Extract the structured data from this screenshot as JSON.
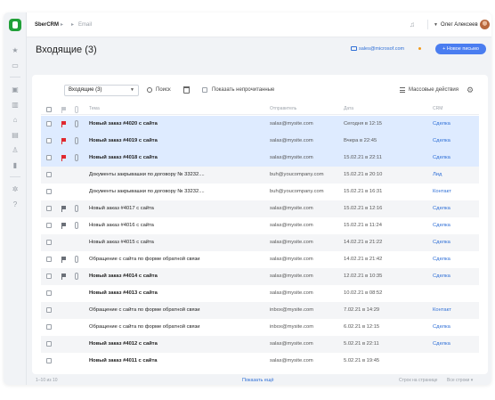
{
  "breadcrumb": {
    "app": "SberCRM",
    "sep": "▸",
    "section": "Email"
  },
  "user": {
    "name": "Олег Алексеев"
  },
  "page": {
    "title": "Входящие (3)",
    "mail_account": "sales@microsof.com",
    "new_email_label": "Новое письмо"
  },
  "toolbar": {
    "folder": "Входящие (3)",
    "search_label": "Поиск",
    "show_unread_label": "Показать непрочитанные",
    "mass_actions_label": "Массовые действия"
  },
  "table": {
    "headers": {
      "subject": "Тема",
      "from": "Отправитель",
      "date": "Дата",
      "crm": "CRM"
    },
    "rows": [
      {
        "selected": true,
        "unread": true,
        "flag": "red",
        "attachment": true,
        "subject": "Новый заказ #4020 с сайта",
        "from": "salas@mysite.com",
        "date": "Сегодня в 12:15",
        "crm": "Сделка"
      },
      {
        "selected": true,
        "unread": true,
        "flag": "red",
        "attachment": true,
        "subject": "Новый заказ #4019 с сайта",
        "from": "salas@mysite.com",
        "date": "Вчера в 22:45",
        "crm": "Сделка"
      },
      {
        "selected": true,
        "unread": true,
        "flag": "red",
        "attachment": true,
        "subject": "Новый заказ #4018 с сайта",
        "from": "salas@mysite.com",
        "date": "15.02.21 в 22:11",
        "crm": "Сделка"
      },
      {
        "selected": false,
        "unread": false,
        "flag": "",
        "attachment": false,
        "subject": "Документы закрывашки по договору № 33232....",
        "from": "buh@youcompany.com",
        "date": "15.02.21 в 20:10",
        "crm": "Лид"
      },
      {
        "selected": false,
        "unread": false,
        "flag": "",
        "attachment": false,
        "subject": "Документы закрывашки по договору № 33232....",
        "from": "buh@youcompany.com",
        "date": "15.02.21 в 16:31",
        "crm": "Контакт"
      },
      {
        "selected": false,
        "unread": false,
        "flag": "gray",
        "attachment": true,
        "subject": "Новый заказ #4017 с сайта",
        "from": "salas@mysite.com",
        "date": "15.02.21 в 12:16",
        "crm": "Сделка"
      },
      {
        "selected": false,
        "unread": false,
        "flag": "gray",
        "attachment": true,
        "subject": "Новый заказ #4016 с сайта",
        "from": "salas@mysite.com",
        "date": "15.02.21 в 11:24",
        "crm": "Сделка"
      },
      {
        "selected": false,
        "unread": false,
        "flag": "",
        "attachment": false,
        "subject": "Новый заказ #4015 с сайта",
        "from": "salas@mysite.com",
        "date": "14.02.21 в 21:22",
        "crm": "Сделка"
      },
      {
        "selected": false,
        "unread": false,
        "flag": "gray",
        "attachment": true,
        "subject": "Обращение с сайта по форме обратной связи",
        "from": "salas@mysite.com",
        "date": "14.02.21 в 21:42",
        "crm": "Сделка"
      },
      {
        "selected": false,
        "unread": true,
        "flag": "gray",
        "attachment": true,
        "subject": "Новый заказ #4014 с сайта",
        "from": "salas@mysite.com",
        "date": "12.02.21 в 10:35",
        "crm": "Сделка"
      },
      {
        "selected": false,
        "unread": true,
        "flag": "",
        "attachment": false,
        "subject": "Новый заказ #4013 с сайта",
        "from": "salas@mysite.com",
        "date": "10.02.21 в 08:52",
        "crm": ""
      },
      {
        "selected": false,
        "unread": false,
        "flag": "",
        "attachment": false,
        "subject": "Обращение с сайта по форме обратной связи",
        "from": "inbox@mysite.com",
        "date": "7.02.21 в 14:29",
        "crm": "Контакт"
      },
      {
        "selected": false,
        "unread": false,
        "flag": "",
        "attachment": false,
        "subject": "Обращение с сайта по форме обратной связи",
        "from": "inbox@mysite.com",
        "date": "6.02.21 в 12:15",
        "crm": "Сделка"
      },
      {
        "selected": false,
        "unread": true,
        "flag": "",
        "attachment": false,
        "subject": "Новый заказ #4012 с сайта",
        "from": "salas@mysite.com",
        "date": "5.02.21 в 22:11",
        "crm": "Сделка"
      },
      {
        "selected": false,
        "unread": true,
        "flag": "",
        "attachment": false,
        "subject": "Новый заказ #4011 с сайта",
        "from": "salas@mysite.com",
        "date": "5.02.21 в 19:45",
        "crm": ""
      }
    ]
  },
  "footer": {
    "count": "1–10 из 10",
    "show_more": "Показать ещё",
    "rows_per_page_label": "Строк на странице",
    "rows_per_page_value": "Все строки"
  },
  "colors": {
    "accent": "#4a7df0",
    "link": "#2f6fd6",
    "selected_row": "#deebff",
    "flag_red": "#e0282e",
    "logo": "#21a038"
  },
  "icons": [
    "logo-icon",
    "star-icon",
    "inbox-icon",
    "briefcase-icon",
    "building-icon",
    "bag-icon",
    "calendar-icon",
    "user-icon",
    "chart-icon",
    "settings-icon",
    "help-icon",
    "bell-icon",
    "search-icon",
    "trash-icon",
    "flag-icon",
    "attachment-icon",
    "gear-icon"
  ]
}
